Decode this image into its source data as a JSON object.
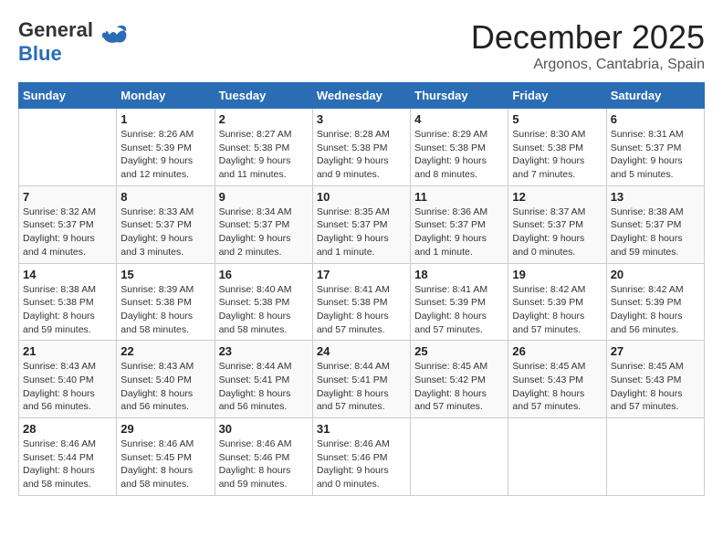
{
  "header": {
    "logo_general": "General",
    "logo_blue": "Blue",
    "month_title": "December 2025",
    "location": "Argonos, Cantabria, Spain"
  },
  "days_of_week": [
    "Sunday",
    "Monday",
    "Tuesday",
    "Wednesday",
    "Thursday",
    "Friday",
    "Saturday"
  ],
  "weeks": [
    [
      {
        "day": "",
        "info": ""
      },
      {
        "day": "1",
        "info": "Sunrise: 8:26 AM\nSunset: 5:39 PM\nDaylight: 9 hours\nand 12 minutes."
      },
      {
        "day": "2",
        "info": "Sunrise: 8:27 AM\nSunset: 5:38 PM\nDaylight: 9 hours\nand 11 minutes."
      },
      {
        "day": "3",
        "info": "Sunrise: 8:28 AM\nSunset: 5:38 PM\nDaylight: 9 hours\nand 9 minutes."
      },
      {
        "day": "4",
        "info": "Sunrise: 8:29 AM\nSunset: 5:38 PM\nDaylight: 9 hours\nand 8 minutes."
      },
      {
        "day": "5",
        "info": "Sunrise: 8:30 AM\nSunset: 5:38 PM\nDaylight: 9 hours\nand 7 minutes."
      },
      {
        "day": "6",
        "info": "Sunrise: 8:31 AM\nSunset: 5:37 PM\nDaylight: 9 hours\nand 5 minutes."
      }
    ],
    [
      {
        "day": "7",
        "info": "Sunrise: 8:32 AM\nSunset: 5:37 PM\nDaylight: 9 hours\nand 4 minutes."
      },
      {
        "day": "8",
        "info": "Sunrise: 8:33 AM\nSunset: 5:37 PM\nDaylight: 9 hours\nand 3 minutes."
      },
      {
        "day": "9",
        "info": "Sunrise: 8:34 AM\nSunset: 5:37 PM\nDaylight: 9 hours\nand 2 minutes."
      },
      {
        "day": "10",
        "info": "Sunrise: 8:35 AM\nSunset: 5:37 PM\nDaylight: 9 hours\nand 1 minute."
      },
      {
        "day": "11",
        "info": "Sunrise: 8:36 AM\nSunset: 5:37 PM\nDaylight: 9 hours\nand 1 minute."
      },
      {
        "day": "12",
        "info": "Sunrise: 8:37 AM\nSunset: 5:37 PM\nDaylight: 9 hours\nand 0 minutes."
      },
      {
        "day": "13",
        "info": "Sunrise: 8:38 AM\nSunset: 5:37 PM\nDaylight: 8 hours\nand 59 minutes."
      }
    ],
    [
      {
        "day": "14",
        "info": "Sunrise: 8:38 AM\nSunset: 5:38 PM\nDaylight: 8 hours\nand 59 minutes."
      },
      {
        "day": "15",
        "info": "Sunrise: 8:39 AM\nSunset: 5:38 PM\nDaylight: 8 hours\nand 58 minutes."
      },
      {
        "day": "16",
        "info": "Sunrise: 8:40 AM\nSunset: 5:38 PM\nDaylight: 8 hours\nand 58 minutes."
      },
      {
        "day": "17",
        "info": "Sunrise: 8:41 AM\nSunset: 5:38 PM\nDaylight: 8 hours\nand 57 minutes."
      },
      {
        "day": "18",
        "info": "Sunrise: 8:41 AM\nSunset: 5:39 PM\nDaylight: 8 hours\nand 57 minutes."
      },
      {
        "day": "19",
        "info": "Sunrise: 8:42 AM\nSunset: 5:39 PM\nDaylight: 8 hours\nand 57 minutes."
      },
      {
        "day": "20",
        "info": "Sunrise: 8:42 AM\nSunset: 5:39 PM\nDaylight: 8 hours\nand 56 minutes."
      }
    ],
    [
      {
        "day": "21",
        "info": "Sunrise: 8:43 AM\nSunset: 5:40 PM\nDaylight: 8 hours\nand 56 minutes."
      },
      {
        "day": "22",
        "info": "Sunrise: 8:43 AM\nSunset: 5:40 PM\nDaylight: 8 hours\nand 56 minutes."
      },
      {
        "day": "23",
        "info": "Sunrise: 8:44 AM\nSunset: 5:41 PM\nDaylight: 8 hours\nand 56 minutes."
      },
      {
        "day": "24",
        "info": "Sunrise: 8:44 AM\nSunset: 5:41 PM\nDaylight: 8 hours\nand 57 minutes."
      },
      {
        "day": "25",
        "info": "Sunrise: 8:45 AM\nSunset: 5:42 PM\nDaylight: 8 hours\nand 57 minutes."
      },
      {
        "day": "26",
        "info": "Sunrise: 8:45 AM\nSunset: 5:43 PM\nDaylight: 8 hours\nand 57 minutes."
      },
      {
        "day": "27",
        "info": "Sunrise: 8:45 AM\nSunset: 5:43 PM\nDaylight: 8 hours\nand 57 minutes."
      }
    ],
    [
      {
        "day": "28",
        "info": "Sunrise: 8:46 AM\nSunset: 5:44 PM\nDaylight: 8 hours\nand 58 minutes."
      },
      {
        "day": "29",
        "info": "Sunrise: 8:46 AM\nSunset: 5:45 PM\nDaylight: 8 hours\nand 58 minutes."
      },
      {
        "day": "30",
        "info": "Sunrise: 8:46 AM\nSunset: 5:46 PM\nDaylight: 8 hours\nand 59 minutes."
      },
      {
        "day": "31",
        "info": "Sunrise: 8:46 AM\nSunset: 5:46 PM\nDaylight: 9 hours\nand 0 minutes."
      },
      {
        "day": "",
        "info": ""
      },
      {
        "day": "",
        "info": ""
      },
      {
        "day": "",
        "info": ""
      }
    ]
  ]
}
